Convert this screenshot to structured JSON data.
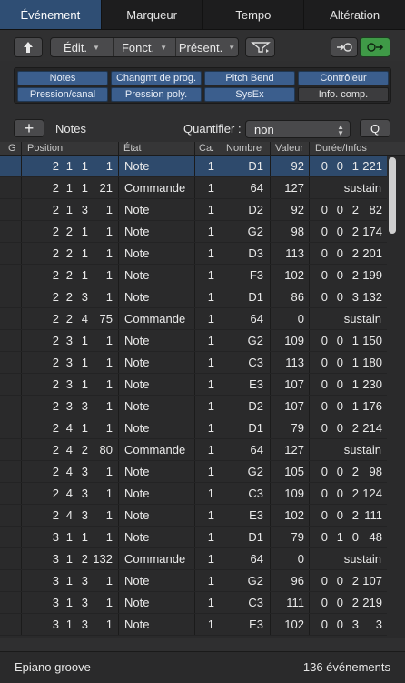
{
  "tabs": [
    "Événement",
    "Marqueur",
    "Tempo",
    "Altération"
  ],
  "toolbar": {
    "up_icon": "up-arrow-icon",
    "menus": [
      "Édit.",
      "Fonct.",
      "Présent."
    ],
    "filter_icon": "midi-filter-icon",
    "in_icon": "midi-in-icon",
    "out_icon": "midi-out-icon"
  },
  "filters": [
    {
      "label": "Notes",
      "on": true
    },
    {
      "label": "Changmt de prog.",
      "on": true
    },
    {
      "label": "Pitch Bend",
      "on": true
    },
    {
      "label": "Contrôleur",
      "on": true
    },
    {
      "label": "Pression/canal",
      "on": true
    },
    {
      "label": "Pression poly.",
      "on": true
    },
    {
      "label": "SysEx",
      "on": true
    },
    {
      "label": "Info. comp.",
      "on": false
    }
  ],
  "listbar": {
    "add": "+",
    "type_label": "Notes",
    "quantize_label": "Quantifier :",
    "quantize_value": "non",
    "q_button": "Q"
  },
  "columns": [
    "G",
    "Position",
    "État",
    "Ca.",
    "Nombre",
    "Valeur",
    "Durée/Infos"
  ],
  "rows": [
    {
      "pos": [
        "2",
        "1",
        "1",
        "1"
      ],
      "state": "Note",
      "ch": "1",
      "num": "D1",
      "val": "92",
      "len": [
        "0",
        "0",
        "1",
        "221"
      ],
      "info": ""
    },
    {
      "pos": [
        "2",
        "1",
        "1",
        "21"
      ],
      "state": "Commande",
      "ch": "1",
      "num": "64",
      "val": "127",
      "len": [],
      "info": "sustain"
    },
    {
      "pos": [
        "2",
        "1",
        "3",
        "1"
      ],
      "state": "Note",
      "ch": "1",
      "num": "D2",
      "val": "92",
      "len": [
        "0",
        "0",
        "2",
        "82"
      ],
      "info": ""
    },
    {
      "pos": [
        "2",
        "2",
        "1",
        "1"
      ],
      "state": "Note",
      "ch": "1",
      "num": "G2",
      "val": "98",
      "len": [
        "0",
        "0",
        "2",
        "174"
      ],
      "info": ""
    },
    {
      "pos": [
        "2",
        "2",
        "1",
        "1"
      ],
      "state": "Note",
      "ch": "1",
      "num": "D3",
      "val": "113",
      "len": [
        "0",
        "0",
        "2",
        "201"
      ],
      "info": ""
    },
    {
      "pos": [
        "2",
        "2",
        "1",
        "1"
      ],
      "state": "Note",
      "ch": "1",
      "num": "F3",
      "val": "102",
      "len": [
        "0",
        "0",
        "2",
        "199"
      ],
      "info": ""
    },
    {
      "pos": [
        "2",
        "2",
        "3",
        "1"
      ],
      "state": "Note",
      "ch": "1",
      "num": "D1",
      "val": "86",
      "len": [
        "0",
        "0",
        "3",
        "132"
      ],
      "info": ""
    },
    {
      "pos": [
        "2",
        "2",
        "4",
        "75"
      ],
      "state": "Commande",
      "ch": "1",
      "num": "64",
      "val": "0",
      "len": [],
      "info": "sustain"
    },
    {
      "pos": [
        "2",
        "3",
        "1",
        "1"
      ],
      "state": "Note",
      "ch": "1",
      "num": "G2",
      "val": "109",
      "len": [
        "0",
        "0",
        "1",
        "150"
      ],
      "info": ""
    },
    {
      "pos": [
        "2",
        "3",
        "1",
        "1"
      ],
      "state": "Note",
      "ch": "1",
      "num": "C3",
      "val": "113",
      "len": [
        "0",
        "0",
        "1",
        "180"
      ],
      "info": ""
    },
    {
      "pos": [
        "2",
        "3",
        "1",
        "1"
      ],
      "state": "Note",
      "ch": "1",
      "num": "E3",
      "val": "107",
      "len": [
        "0",
        "0",
        "1",
        "230"
      ],
      "info": ""
    },
    {
      "pos": [
        "2",
        "3",
        "3",
        "1"
      ],
      "state": "Note",
      "ch": "1",
      "num": "D2",
      "val": "107",
      "len": [
        "0",
        "0",
        "1",
        "176"
      ],
      "info": ""
    },
    {
      "pos": [
        "2",
        "4",
        "1",
        "1"
      ],
      "state": "Note",
      "ch": "1",
      "num": "D1",
      "val": "79",
      "len": [
        "0",
        "0",
        "2",
        "214"
      ],
      "info": ""
    },
    {
      "pos": [
        "2",
        "4",
        "2",
        "80"
      ],
      "state": "Commande",
      "ch": "1",
      "num": "64",
      "val": "127",
      "len": [],
      "info": "sustain"
    },
    {
      "pos": [
        "2",
        "4",
        "3",
        "1"
      ],
      "state": "Note",
      "ch": "1",
      "num": "G2",
      "val": "105",
      "len": [
        "0",
        "0",
        "2",
        "98"
      ],
      "info": ""
    },
    {
      "pos": [
        "2",
        "4",
        "3",
        "1"
      ],
      "state": "Note",
      "ch": "1",
      "num": "C3",
      "val": "109",
      "len": [
        "0",
        "0",
        "2",
        "124"
      ],
      "info": ""
    },
    {
      "pos": [
        "2",
        "4",
        "3",
        "1"
      ],
      "state": "Note",
      "ch": "1",
      "num": "E3",
      "val": "102",
      "len": [
        "0",
        "0",
        "2",
        "111"
      ],
      "info": ""
    },
    {
      "pos": [
        "3",
        "1",
        "1",
        "1"
      ],
      "state": "Note",
      "ch": "1",
      "num": "D1",
      "val": "79",
      "len": [
        "0",
        "1",
        "0",
        "48"
      ],
      "info": ""
    },
    {
      "pos": [
        "3",
        "1",
        "2",
        "132"
      ],
      "state": "Commande",
      "ch": "1",
      "num": "64",
      "val": "0",
      "len": [],
      "info": "sustain"
    },
    {
      "pos": [
        "3",
        "1",
        "3",
        "1"
      ],
      "state": "Note",
      "ch": "1",
      "num": "G2",
      "val": "96",
      "len": [
        "0",
        "0",
        "2",
        "107"
      ],
      "info": ""
    },
    {
      "pos": [
        "3",
        "1",
        "3",
        "1"
      ],
      "state": "Note",
      "ch": "1",
      "num": "C3",
      "val": "111",
      "len": [
        "0",
        "0",
        "2",
        "219"
      ],
      "info": ""
    },
    {
      "pos": [
        "3",
        "1",
        "3",
        "1"
      ],
      "state": "Note",
      "ch": "1",
      "num": "E3",
      "val": "102",
      "len": [
        "0",
        "0",
        "3",
        "3"
      ],
      "info": ""
    }
  ],
  "status": {
    "region": "Epiano groove",
    "count": "136 événements"
  },
  "colors": {
    "accent": "#2f4e74",
    "filter_on": "#3b5e8d",
    "out_active": "#3f9a47"
  }
}
